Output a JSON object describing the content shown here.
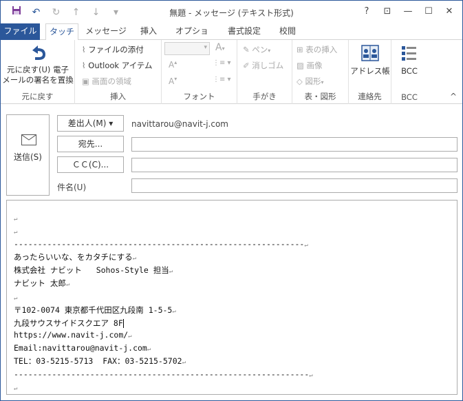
{
  "window": {
    "title": "無題 - メッセージ (テキスト形式)",
    "controls": {
      "help": "?",
      "restore_ribbon": "⊡",
      "minimize": "—",
      "maximize": "☐",
      "close": "✕"
    }
  },
  "qat": {
    "save": "save-icon",
    "undo": "↶",
    "redo": "↻",
    "up": "↑",
    "down": "↓",
    "customize": "▾"
  },
  "tabs": [
    "ファイル",
    "タッチ",
    "メッセージ",
    "挿入",
    "オプション",
    "書式設定",
    "校閲"
  ],
  "ribbon": {
    "revert": {
      "line1": "元に戻す(U) 電子",
      "line2": "メールの署名を置換",
      "group": "元に戻す"
    },
    "insert": {
      "attach_file": "ファイルの添付",
      "outlook_item": "Outlook アイテム",
      "screen_clip": "画面の領域",
      "group": "挿入"
    },
    "font": {
      "font_size_up": "A",
      "font_size_down": "A",
      "clear": "A",
      "group": "フォント"
    },
    "ink": {
      "pen": "ペン",
      "eraser": "消しゴム",
      "group": "手がき"
    },
    "table": {
      "insert_table": "表の挿入",
      "picture": "画像",
      "shapes": "図形",
      "group": "表・図形"
    },
    "names": {
      "address_book": "アドレス帳",
      "group": "連絡先"
    },
    "bcc": {
      "label": "BCC",
      "group": "BCC"
    },
    "collapse": "^"
  },
  "compose": {
    "send_label": "送信(S)",
    "from_label": "差出人(M) ▾",
    "from_value": "navittarou@navit-j.com",
    "to_label": "宛先...",
    "cc_label": "ＣＣ(C)...",
    "subject_label": "件名(U)"
  },
  "body_lines": [
    "",
    "",
    "-------------------------------------------------------------",
    "あったらいいな、をカタチにする",
    "株式会社 ナビット   Sohos-Style 担当",
    "ナビット 太郎",
    "",
    "〒102-0074 東京都千代田区九段南 1-5-5",
    "九段サウスサイドスクエア 8F",
    "https://www.navit-j.com/",
    "Email:navittarou@navit-j.com",
    "TEL：03-5215-5713  FAX：03-5215-5702",
    "--------------------------------------------------------------",
    ""
  ],
  "return_mark": "↵"
}
